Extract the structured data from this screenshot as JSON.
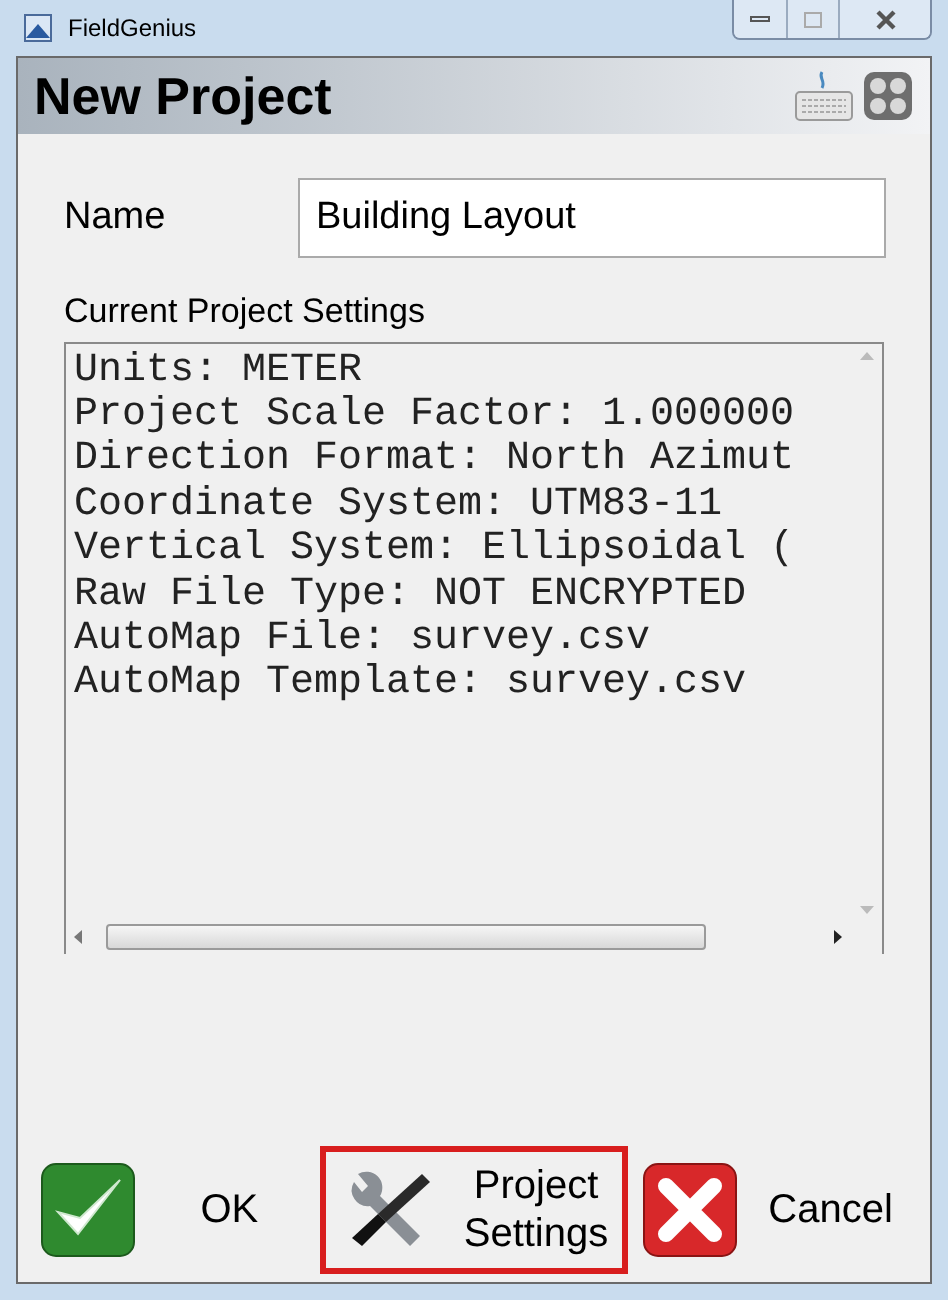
{
  "window": {
    "title": "FieldGenius"
  },
  "header": {
    "title": "New Project"
  },
  "name_field": {
    "label": "Name",
    "value": "Building Layout"
  },
  "settings": {
    "label": "Current Project Settings",
    "lines": [
      "Units: METER",
      "Project Scale Factor: 1.000000",
      "Direction Format: North Azimut",
      "Coordinate System: UTM83-11",
      "Vertical System: Ellipsoidal (",
      "Raw File Type: NOT ENCRYPTED",
      "AutoMap File: survey.csv",
      "AutoMap Template: survey.csv"
    ]
  },
  "buttons": [
    {
      "kind": "ok",
      "label": "OK",
      "highlighted": false
    },
    {
      "kind": "settings",
      "label": "Project Settings",
      "highlighted": true
    },
    {
      "kind": "cancel",
      "label": "Cancel",
      "highlighted": false
    }
  ]
}
